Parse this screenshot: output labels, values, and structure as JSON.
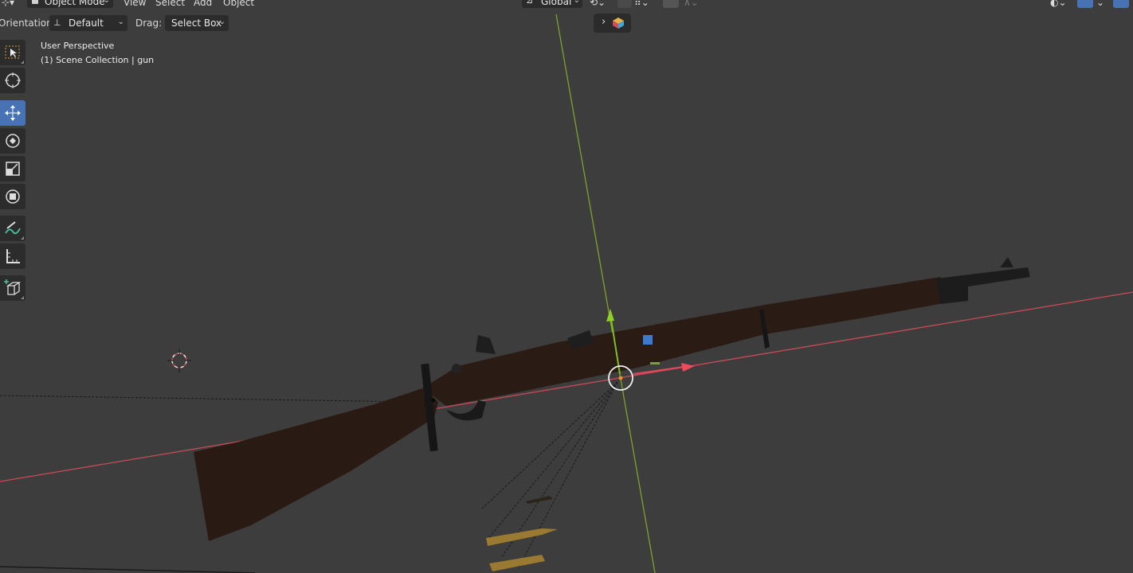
{
  "header": {
    "mode_label": "Object Mode",
    "menus": [
      "View",
      "Select",
      "Add",
      "Object"
    ],
    "transform_space": "Global"
  },
  "tool_header": {
    "orientation_label": "Orientation:",
    "orientation_value": "Default",
    "drag_label": "Drag:",
    "drag_value": "Select Box"
  },
  "viewport": {
    "view_name": "User Perspective",
    "collection_info": "(1) Scene Collection | gun"
  },
  "tools": [
    {
      "name": "select-box",
      "icon": "select-box-icon",
      "active": false
    },
    {
      "name": "cursor",
      "icon": "cursor-icon",
      "active": false
    },
    {
      "name": "move",
      "icon": "move-icon",
      "active": true
    },
    {
      "name": "rotate",
      "icon": "rotate-icon",
      "active": false
    },
    {
      "name": "scale",
      "icon": "scale-icon",
      "active": false
    },
    {
      "name": "transform",
      "icon": "transform-icon",
      "active": false
    },
    {
      "name": "annotate",
      "icon": "annotate-icon",
      "active": false
    },
    {
      "name": "measure",
      "icon": "measure-icon",
      "active": false
    },
    {
      "name": "add-cube",
      "icon": "add-cube-icon",
      "active": false
    }
  ],
  "colors": {
    "background": "#3d3d3d",
    "panel": "#2b2b2b",
    "active_tool": "#4772b3",
    "x_axis": "#d8475a",
    "y_axis": "#8bb023",
    "z_axis": "#4a7fd0",
    "stock": "#2a1a14"
  }
}
